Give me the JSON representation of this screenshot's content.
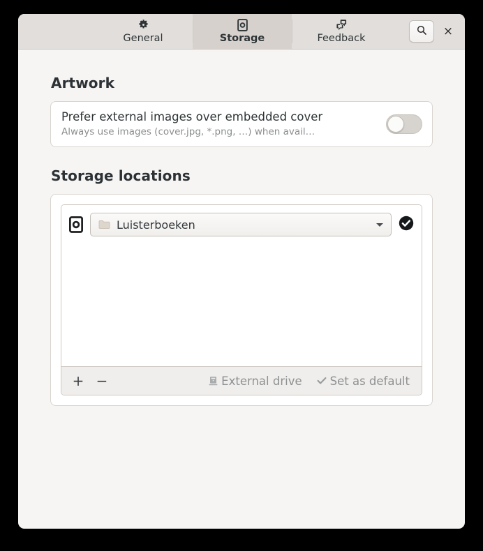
{
  "window": {
    "tabs": [
      {
        "label": "General",
        "icon": "gear-icon",
        "active": false
      },
      {
        "label": "Storage",
        "icon": "drive-icon",
        "active": true
      },
      {
        "label": "Feedback",
        "icon": "chat-bubbles-icon",
        "active": false
      }
    ],
    "search_icon": "search-icon",
    "close_label": "×"
  },
  "artwork": {
    "heading": "Artwork",
    "row": {
      "title": "Prefer external images over embedded cover",
      "subtitle": "Always use images (cover.jpg, *.png, …) when avail…",
      "toggle_state": "off"
    }
  },
  "storage": {
    "heading": "Storage locations",
    "location": {
      "drive_icon": "drive-icon",
      "folder_icon": "folder-icon",
      "name": "Luisterboeken",
      "default_badge_icon": "check-circle-icon"
    },
    "toolbar": {
      "add_label": "+",
      "remove_label": "−",
      "external_drive_label": "External drive",
      "external_drive_icon": "external-drive-icon",
      "set_default_label": "Set as default",
      "set_default_icon": "check-icon"
    }
  },
  "colors": {
    "window_bg": "#f6f5f4",
    "headerbar_bg": "#e1dedb",
    "active_tab_bg": "#d6d1cd",
    "card_bg": "#ffffff",
    "text_primary": "#2e3436",
    "text_dim": "#8b8e8f",
    "border": "#d9d4cf"
  }
}
